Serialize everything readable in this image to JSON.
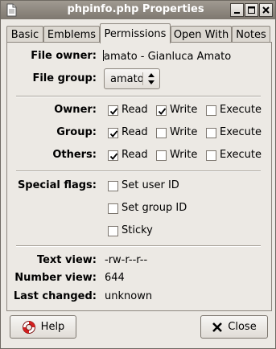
{
  "window": {
    "title": "phpinfo.php Properties"
  },
  "tabs": [
    {
      "label": "Basic"
    },
    {
      "label": "Emblems"
    },
    {
      "label": "Permissions"
    },
    {
      "label": "Open With"
    },
    {
      "label": "Notes"
    }
  ],
  "active_tab": "Permissions",
  "owner_section": {
    "file_owner_label": "File owner:",
    "file_owner_value": "amato - Gianluca Amato",
    "file_group_label": "File group:",
    "file_group_value": "amato"
  },
  "permissions": {
    "rows": [
      {
        "label": "Owner:",
        "read": true,
        "write": true,
        "execute": false
      },
      {
        "label": "Group:",
        "read": true,
        "write": false,
        "execute": false
      },
      {
        "label": "Others:",
        "read": true,
        "write": false,
        "execute": false
      }
    ],
    "read_label": "Read",
    "write_label": "Write",
    "execute_label": "Execute"
  },
  "special_flags": {
    "label": "Special flags:",
    "set_user_id": {
      "label": "Set user ID",
      "checked": false
    },
    "set_group_id": {
      "label": "Set group ID",
      "checked": false
    },
    "sticky": {
      "label": "Sticky",
      "checked": false
    }
  },
  "info": {
    "text_view_label": "Text view:",
    "text_view_value": "-rw-r--r--",
    "number_view_label": "Number view:",
    "number_view_value": "644",
    "last_changed_label": "Last changed:",
    "last_changed_value": "unknown"
  },
  "buttons": {
    "help_label": "Help",
    "close_label": "Close"
  },
  "icons": {
    "window_icon": "file-icon",
    "minimize": "minimize-icon",
    "maximize": "maximize-icon",
    "close": "close-icon",
    "help": "lifebuoy-icon",
    "close_button": "x-icon"
  }
}
